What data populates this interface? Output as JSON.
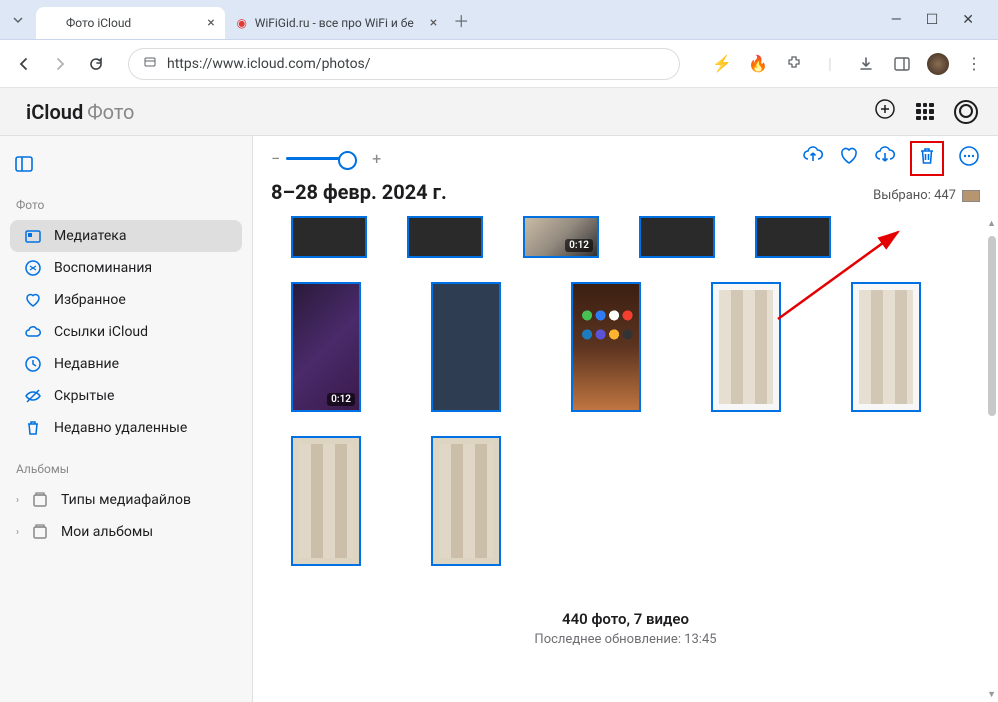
{
  "browser": {
    "tabs": [
      {
        "favicon": "apple",
        "title": "Фото iCloud",
        "active": true
      },
      {
        "favicon": "wifi",
        "title": "WiFiGid.ru - все про WiFi и бе",
        "active": false
      }
    ],
    "url": "https://www.icloud.com/photos/"
  },
  "app": {
    "title_main": "iCloud",
    "title_sub": "Фото"
  },
  "sidebar": {
    "section1": "Фото",
    "items": [
      {
        "icon": "library",
        "label": "Медиатека",
        "active": true
      },
      {
        "icon": "memories",
        "label": "Воспоминания"
      },
      {
        "icon": "heart",
        "label": "Избранное"
      },
      {
        "icon": "cloud",
        "label": "Ссылки iCloud"
      },
      {
        "icon": "recent",
        "label": "Недавние"
      },
      {
        "icon": "hidden",
        "label": "Скрытые"
      },
      {
        "icon": "trash",
        "label": "Недавно удаленные"
      }
    ],
    "section2": "Альбомы",
    "albums": [
      {
        "label": "Типы медиафайлов"
      },
      {
        "label": "Мои альбомы"
      }
    ]
  },
  "content": {
    "date_range": "8–28 февр. 2024 г.",
    "selected_label": "Выбрано: 447",
    "row1": [
      {
        "kind": "dark"
      },
      {
        "kind": "dark"
      },
      {
        "kind": "closeup",
        "duration": "0:12"
      },
      {
        "kind": "dark"
      },
      {
        "kind": "dark"
      }
    ],
    "row2": [
      {
        "kind": "keyboard",
        "duration": "0:12"
      },
      {
        "kind": "blue"
      },
      {
        "kind": "homescreen"
      },
      {
        "kind": "white"
      },
      {
        "kind": "white"
      }
    ],
    "row3": [
      {
        "kind": "gallery"
      },
      {
        "kind": "gallery"
      }
    ],
    "footer_main": "440 фото, 7 видео",
    "footer_sub": "Последнее обновление: 13:45"
  }
}
